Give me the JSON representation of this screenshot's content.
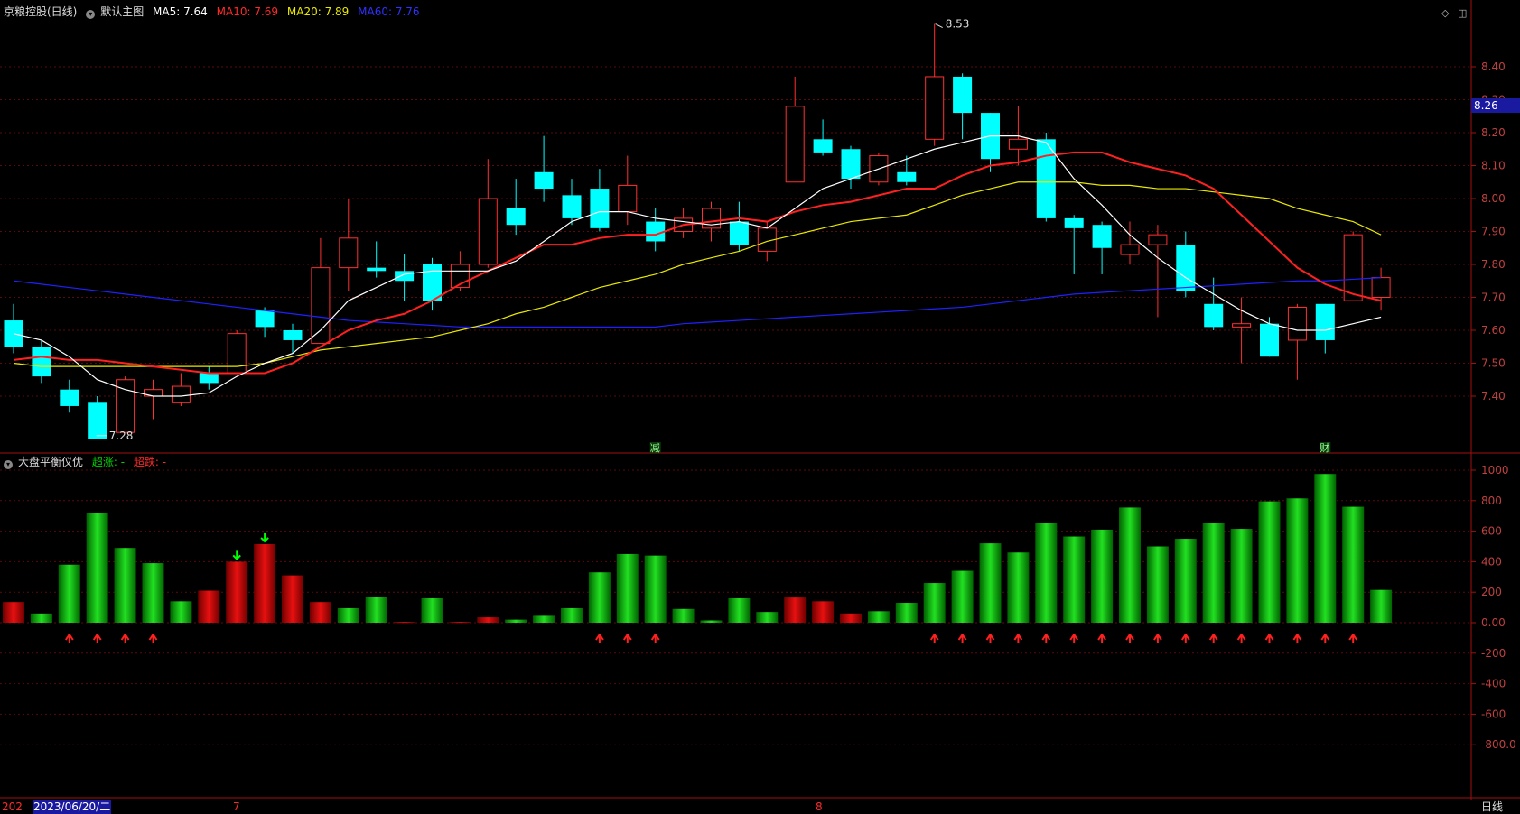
{
  "main_header": {
    "stock": "京粮控股(日线)",
    "template": "默认主图",
    "ma5_label": "MA5: 7.64",
    "ma10_label": "MA10: 7.69",
    "ma20_label": "MA20: 7.89",
    "ma60_label": "MA60: 7.76"
  },
  "sub_header": {
    "name": "大盘平衡仪优",
    "up_label": "超涨: -",
    "down_label": "超跌: -"
  },
  "colors": {
    "up": "#ff3030",
    "down": "#00ffff",
    "ma5": "#ffffff",
    "ma10": "#ff2020",
    "ma20": "#e8e800",
    "ma60": "#2020ff",
    "bar_green": "#00c800",
    "bar_red": "#d00000",
    "axis": "#a01010"
  },
  "bottom": {
    "year_stub": "202",
    "date": "2023/06/20/二",
    "month_7": "7",
    "month_8": "8",
    "period": "日线"
  },
  "price_tag": "8.26",
  "chart_data": [
    {
      "type": "candlestick",
      "yticks": [
        7.4,
        7.5,
        7.6,
        7.7,
        7.8,
        7.9,
        8.0,
        8.1,
        8.2,
        8.3,
        8.4
      ],
      "ylim": [
        7.2,
        8.55
      ],
      "high_label": "8.53",
      "low_label": "7.28",
      "markers": [
        {
          "index": 23,
          "text": "减"
        },
        {
          "index": 47,
          "text": "财"
        }
      ],
      "candles": [
        [
          7.63,
          7.55,
          7.68,
          7.53
        ],
        [
          7.55,
          7.46,
          7.57,
          7.44
        ],
        [
          7.42,
          7.37,
          7.45,
          7.35
        ],
        [
          7.38,
          7.27,
          7.4,
          7.28
        ],
        [
          7.29,
          7.45,
          7.46,
          7.29
        ],
        [
          7.4,
          7.42,
          7.45,
          7.33
        ],
        [
          7.38,
          7.43,
          7.47,
          7.37
        ],
        [
          7.47,
          7.44,
          7.49,
          7.42
        ],
        [
          7.47,
          7.59,
          7.6,
          7.47
        ],
        [
          7.66,
          7.61,
          7.67,
          7.58
        ],
        [
          7.6,
          7.57,
          7.62,
          7.53
        ],
        [
          7.56,
          7.79,
          7.88,
          7.56
        ],
        [
          7.79,
          7.88,
          8.0,
          7.72
        ],
        [
          7.79,
          7.78,
          7.87,
          7.76
        ],
        [
          7.78,
          7.75,
          7.83,
          7.69
        ],
        [
          7.8,
          7.69,
          7.82,
          7.66
        ],
        [
          7.73,
          7.8,
          7.84,
          7.72
        ],
        [
          7.8,
          8.0,
          8.12,
          7.79
        ],
        [
          7.97,
          7.92,
          8.06,
          7.89
        ],
        [
          8.08,
          8.03,
          8.19,
          7.99
        ],
        [
          8.01,
          7.94,
          8.06,
          7.92
        ],
        [
          8.03,
          7.91,
          8.09,
          7.9
        ],
        [
          7.96,
          8.04,
          8.13,
          7.92
        ],
        [
          7.93,
          7.87,
          7.97,
          7.84
        ],
        [
          7.9,
          7.94,
          7.97,
          7.88
        ],
        [
          7.91,
          7.97,
          7.99,
          7.87
        ],
        [
          7.93,
          7.86,
          7.99,
          7.84
        ],
        [
          7.84,
          7.91,
          7.93,
          7.81
        ],
        [
          8.05,
          8.28,
          8.37,
          8.05
        ],
        [
          8.18,
          8.14,
          8.24,
          8.13
        ],
        [
          8.15,
          8.06,
          8.16,
          8.03
        ],
        [
          8.05,
          8.13,
          8.14,
          8.04
        ],
        [
          8.08,
          8.05,
          8.13,
          8.04
        ],
        [
          8.18,
          8.37,
          8.53,
          8.16
        ],
        [
          8.37,
          8.26,
          8.38,
          8.18
        ],
        [
          8.26,
          8.12,
          8.26,
          8.08
        ],
        [
          8.15,
          8.18,
          8.28,
          8.1
        ],
        [
          8.18,
          7.94,
          8.2,
          7.93
        ],
        [
          7.94,
          7.91,
          7.95,
          7.77
        ],
        [
          7.92,
          7.85,
          7.93,
          7.77
        ],
        [
          7.83,
          7.86,
          7.93,
          7.8
        ],
        [
          7.86,
          7.89,
          7.92,
          7.64
        ],
        [
          7.86,
          7.72,
          7.9,
          7.7
        ],
        [
          7.68,
          7.61,
          7.76,
          7.6
        ],
        [
          7.61,
          7.62,
          7.7,
          7.5
        ],
        [
          7.62,
          7.52,
          7.64,
          7.52
        ],
        [
          7.57,
          7.67,
          7.68,
          7.45
        ],
        [
          7.68,
          7.57,
          7.68,
          7.53
        ],
        [
          7.69,
          7.89,
          7.9,
          7.69
        ],
        [
          7.7,
          7.76,
          7.79,
          7.66
        ]
      ],
      "ma5": [
        7.59,
        7.57,
        7.52,
        7.45,
        7.42,
        7.4,
        7.4,
        7.41,
        7.46,
        7.5,
        7.53,
        7.6,
        7.69,
        7.73,
        7.77,
        7.78,
        7.78,
        7.78,
        7.81,
        7.87,
        7.93,
        7.96,
        7.96,
        7.94,
        7.93,
        7.92,
        7.93,
        7.91,
        7.97,
        8.03,
        8.06,
        8.09,
        8.12,
        8.15,
        8.17,
        8.19,
        8.19,
        8.17,
        8.06,
        7.98,
        7.89,
        7.82,
        7.76,
        7.71,
        7.66,
        7.62,
        7.6,
        7.6,
        7.62,
        7.64
      ],
      "ma10": [
        7.51,
        7.52,
        7.51,
        7.51,
        7.5,
        7.49,
        7.48,
        7.47,
        7.47,
        7.47,
        7.5,
        7.55,
        7.6,
        7.63,
        7.65,
        7.69,
        7.74,
        7.78,
        7.82,
        7.86,
        7.86,
        7.88,
        7.89,
        7.89,
        7.92,
        7.93,
        7.94,
        7.93,
        7.96,
        7.98,
        7.99,
        8.01,
        8.03,
        8.03,
        8.07,
        8.1,
        8.11,
        8.13,
        8.14,
        8.14,
        8.11,
        8.09,
        8.07,
        8.03,
        7.95,
        7.87,
        7.79,
        7.74,
        7.71,
        7.69
      ],
      "ma20": [
        7.5,
        7.49,
        7.49,
        7.49,
        7.49,
        7.49,
        7.49,
        7.49,
        7.49,
        7.5,
        7.52,
        7.54,
        7.55,
        7.56,
        7.57,
        7.58,
        7.6,
        7.62,
        7.65,
        7.67,
        7.7,
        7.73,
        7.75,
        7.77,
        7.8,
        7.82,
        7.84,
        7.87,
        7.89,
        7.91,
        7.93,
        7.94,
        7.95,
        7.98,
        8.01,
        8.03,
        8.05,
        8.05,
        8.05,
        8.04,
        8.04,
        8.03,
        8.03,
        8.02,
        8.01,
        8.0,
        7.97,
        7.95,
        7.93,
        7.89
      ],
      "ma60": [
        7.75,
        7.74,
        7.73,
        7.72,
        7.71,
        7.7,
        7.69,
        7.68,
        7.67,
        7.66,
        7.65,
        7.64,
        7.63,
        7.625,
        7.62,
        7.615,
        7.61,
        7.61,
        7.61,
        7.61,
        7.61,
        7.61,
        7.61,
        7.61,
        7.62,
        7.625,
        7.63,
        7.635,
        7.64,
        7.645,
        7.65,
        7.655,
        7.66,
        7.665,
        7.67,
        7.68,
        7.69,
        7.7,
        7.71,
        7.715,
        7.72,
        7.725,
        7.73,
        7.735,
        7.74,
        7.745,
        7.75,
        7.75,
        7.755,
        7.76
      ]
    },
    {
      "type": "bar",
      "yticks": [
        1000,
        800,
        600,
        400,
        200,
        0,
        -200,
        -400,
        -600,
        -800
      ],
      "ytick_labels": [
        "1000",
        "800",
        "600",
        "400",
        "200",
        "0.00",
        "-200",
        "-400",
        "-600",
        "-800.0"
      ],
      "ylim": [
        -1000,
        1050
      ],
      "values": [
        135,
        60,
        380,
        720,
        490,
        390,
        140,
        210,
        400,
        515,
        310,
        135,
        95,
        170,
        5,
        160,
        5,
        35,
        20,
        45,
        95,
        330,
        450,
        440,
        90,
        15,
        160,
        70,
        165,
        140,
        60,
        75,
        130,
        260,
        340,
        520,
        460,
        655,
        565,
        610,
        755,
        500,
        550,
        655,
        615,
        795,
        815,
        975,
        760,
        215
      ],
      "colors": [
        "r",
        "g",
        "g",
        "g",
        "g",
        "g",
        "g",
        "r",
        "r",
        "r",
        "r",
        "r",
        "g",
        "g",
        "r",
        "g",
        "r",
        "r",
        "g",
        "g",
        "g",
        "g",
        "g",
        "g",
        "g",
        "g",
        "g",
        "g",
        "r",
        "r",
        "r",
        "g",
        "g",
        "g",
        "g",
        "g",
        "g",
        "g",
        "g",
        "g",
        "g",
        "g",
        "g",
        "g",
        "g",
        "g",
        "g",
        "g",
        "g",
        "g"
      ],
      "up_arrows": [
        2,
        3,
        4,
        5,
        21,
        22,
        23,
        33,
        34,
        35,
        36,
        37,
        38,
        39,
        40,
        41,
        42,
        43,
        44,
        45,
        46,
        47,
        48
      ],
      "down_arrows": [
        8,
        9
      ]
    }
  ]
}
